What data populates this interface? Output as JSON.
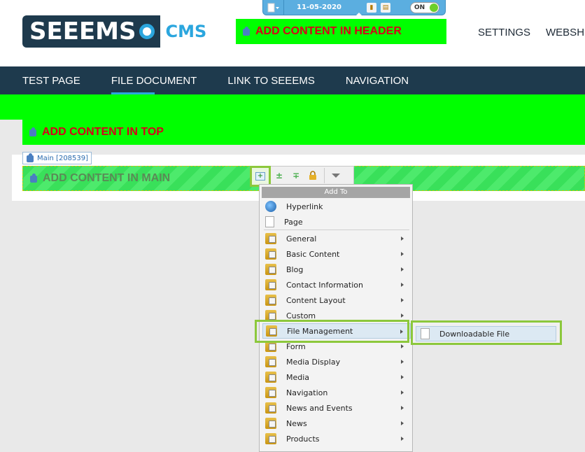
{
  "brand": {
    "logo_text": "SEEEMS",
    "logo_suffix": "CMS"
  },
  "cms_toolbar": {
    "date": "11-05-2020",
    "toggle_label": "ON"
  },
  "header_zone": {
    "label": "ADD CONTENT IN HEADER"
  },
  "top_links": [
    "SETTINGS",
    "WEBSH"
  ],
  "nav": {
    "items": [
      {
        "label": "TEST PAGE"
      },
      {
        "label": "FILE DOCUMENT"
      },
      {
        "label": "LINK TO SEEEMS"
      },
      {
        "label": "NAVIGATION"
      }
    ]
  },
  "top_zone": {
    "label": "ADD CONTENT IN TOP"
  },
  "main_zone": {
    "tag": "Main [208539]",
    "label": "ADD CONTENT IN MAIN"
  },
  "menu": {
    "header": "Add To",
    "items": [
      {
        "label": "Hyperlink",
        "icon": "globe-icon",
        "submenu": false
      },
      {
        "label": "Page",
        "icon": "page-icon",
        "submenu": false
      },
      {
        "label": "General",
        "icon": "folder-icon",
        "submenu": true
      },
      {
        "label": "Basic Content",
        "icon": "folder-icon",
        "submenu": true
      },
      {
        "label": "Blog",
        "icon": "folder-icon",
        "submenu": true
      },
      {
        "label": "Contact Information",
        "icon": "folder-icon",
        "submenu": true
      },
      {
        "label": "Content Layout",
        "icon": "folder-icon",
        "submenu": true
      },
      {
        "label": "Custom",
        "icon": "folder-icon",
        "submenu": true
      },
      {
        "label": "File Management",
        "icon": "folder-icon",
        "submenu": true
      },
      {
        "label": "Form",
        "icon": "folder-icon",
        "submenu": true
      },
      {
        "label": "Media Display",
        "icon": "folder-icon",
        "submenu": true
      },
      {
        "label": "Media",
        "icon": "folder-icon",
        "submenu": true
      },
      {
        "label": "Navigation",
        "icon": "folder-icon",
        "submenu": true
      },
      {
        "label": "News and Events",
        "icon": "folder-icon",
        "submenu": true
      },
      {
        "label": "News",
        "icon": "folder-icon",
        "submenu": true
      },
      {
        "label": "Products",
        "icon": "folder-icon",
        "submenu": true
      }
    ]
  },
  "submenu": {
    "items": [
      {
        "label": "Downloadable File"
      }
    ]
  },
  "colors": {
    "zone_green": "#00ff00",
    "label_red": "#d8001a",
    "nav_bg": "#1e3a4d",
    "accent": "#2ba6de",
    "highlight": "#8cc83c"
  }
}
